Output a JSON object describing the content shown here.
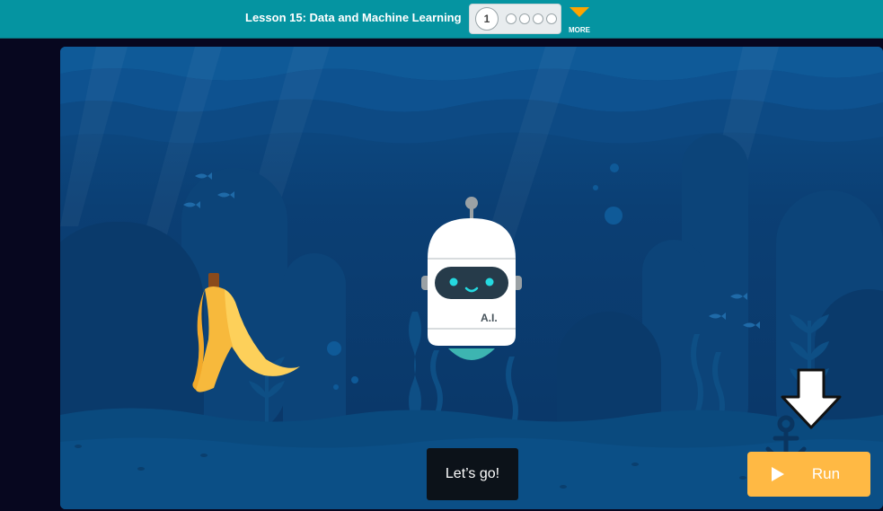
{
  "header": {
    "lesson_title": "Lesson 15: Data and Machine Learning",
    "current_level": "1",
    "more_label": "MORE"
  },
  "stage": {
    "robot_label": "A.I.",
    "speech_text": "Let’s go!",
    "item_icon": "banana-peel-icon"
  },
  "controls": {
    "run_label": "Run"
  },
  "colors": {
    "header_bg": "#0594a1",
    "run_button": "#ffb944",
    "water_dark": "#0b3a6c",
    "robot_eyes": "#25d9e0"
  }
}
